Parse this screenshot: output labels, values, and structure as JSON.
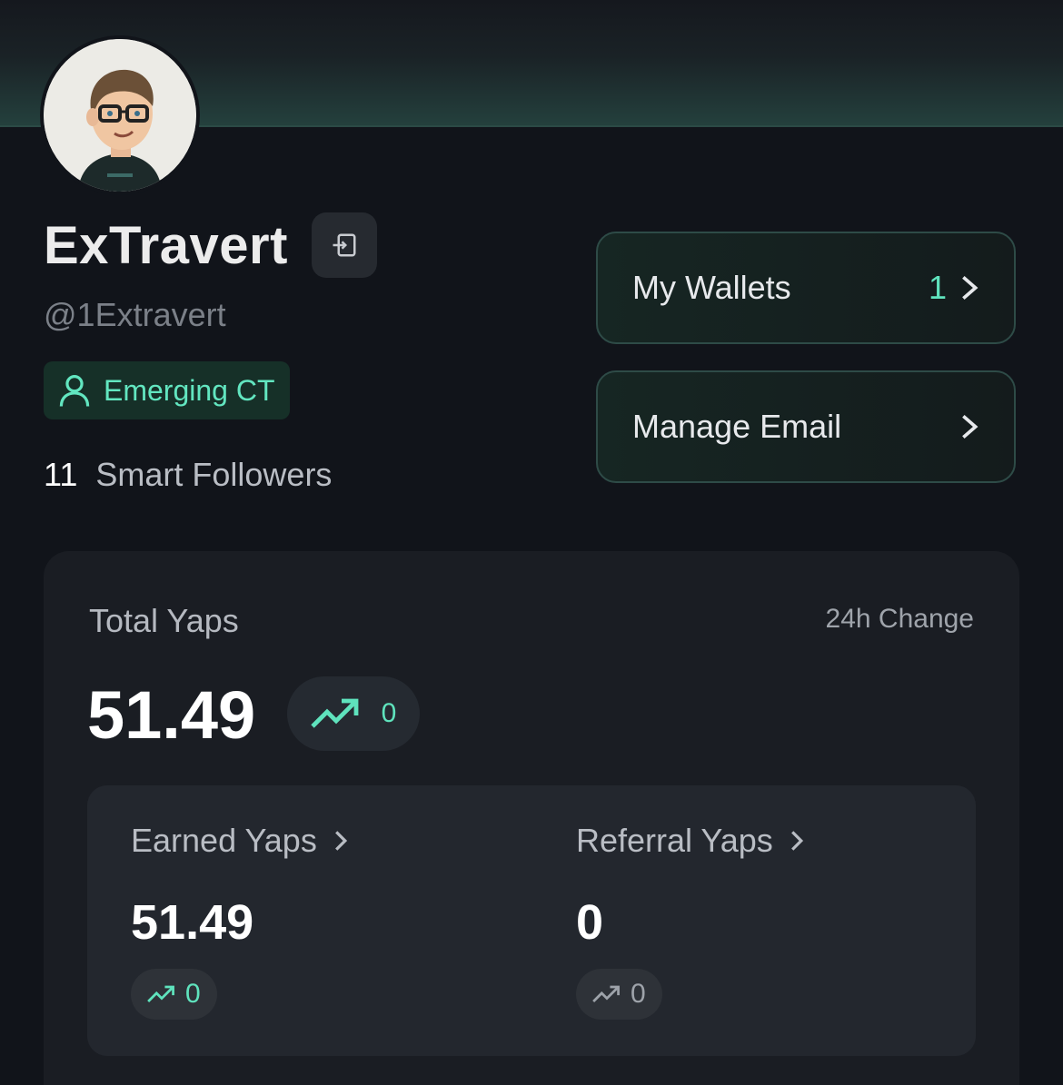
{
  "profile": {
    "display_name": "ExTravert",
    "handle": "@1Extravert",
    "tier": "Emerging CT",
    "smart_followers_count": "11",
    "smart_followers_label": "Smart Followers"
  },
  "actions": {
    "wallets_label": "My Wallets",
    "wallets_count": "1",
    "email_label": "Manage Email"
  },
  "yaps": {
    "title": "Total Yaps",
    "change_label": "24h Change",
    "total": "51.49",
    "total_change": "0",
    "earned_label": "Earned Yaps",
    "earned_value": "51.49",
    "earned_change": "0",
    "referral_label": "Referral Yaps",
    "referral_value": "0",
    "referral_change": "0"
  },
  "colors": {
    "accent": "#5fe3bd",
    "background": "#11141a",
    "card": "#1a1d23"
  }
}
